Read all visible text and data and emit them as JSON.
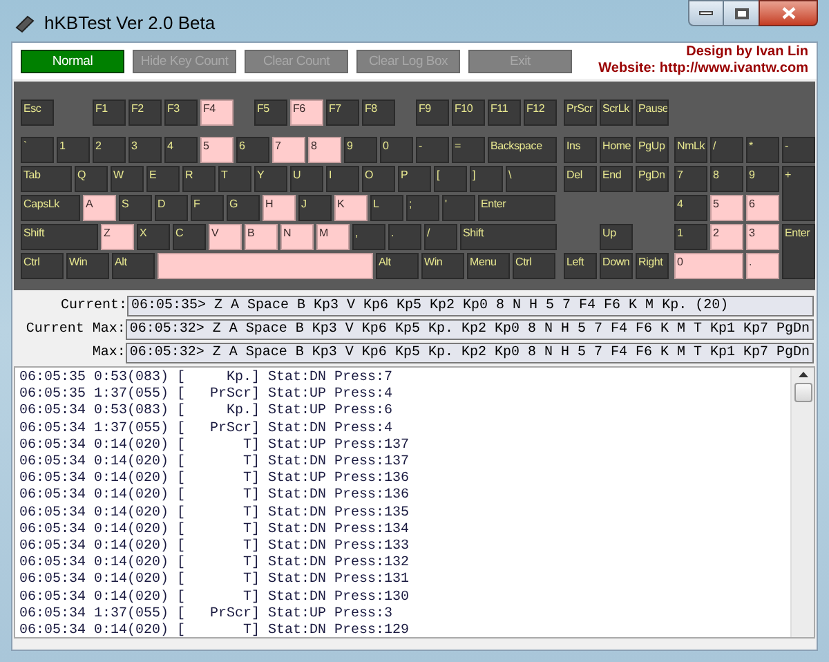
{
  "window": {
    "title": "hKBTest Ver 2.0 Beta"
  },
  "toolbar": {
    "buttons": [
      {
        "label": "Normal",
        "selected": true
      },
      {
        "label": "Hide Key Count",
        "selected": false
      },
      {
        "label": "Clear Count",
        "selected": false
      },
      {
        "label": "Clear Log Box",
        "selected": false
      },
      {
        "label": "Exit",
        "selected": false
      }
    ],
    "credits": [
      "Design by Ivan Lin",
      "Website: http://www.ivantw.com"
    ]
  },
  "keyboard": {
    "function_keys": [
      {
        "label": "Esc",
        "pressed": false
      },
      {
        "label": "F1",
        "pressed": false
      },
      {
        "label": "F2",
        "pressed": false
      },
      {
        "label": "F3",
        "pressed": false
      },
      {
        "label": "F4",
        "pressed": true
      },
      {
        "label": "F5",
        "pressed": false
      },
      {
        "label": "F6",
        "pressed": true
      },
      {
        "label": "F7",
        "pressed": false
      },
      {
        "label": "F8",
        "pressed": false
      },
      {
        "label": "F9",
        "pressed": false
      },
      {
        "label": "F10",
        "pressed": false
      },
      {
        "label": "F11",
        "pressed": false
      },
      {
        "label": "F12",
        "pressed": false
      }
    ],
    "main_rows": [
      [
        {
          "label": "`",
          "pressed": false
        },
        {
          "label": "1",
          "pressed": false
        },
        {
          "label": "2",
          "pressed": false
        },
        {
          "label": "3",
          "pressed": false
        },
        {
          "label": "4",
          "pressed": false
        },
        {
          "label": "5",
          "pressed": true
        },
        {
          "label": "6",
          "pressed": false
        },
        {
          "label": "7",
          "pressed": true
        },
        {
          "label": "8",
          "pressed": true
        },
        {
          "label": "9",
          "pressed": false
        },
        {
          "label": "0",
          "pressed": false
        },
        {
          "label": "-",
          "pressed": false
        },
        {
          "label": "=",
          "pressed": false
        },
        {
          "label": "Backspace",
          "pressed": false
        }
      ],
      [
        {
          "label": "Tab",
          "pressed": false
        },
        {
          "label": "Q",
          "pressed": false
        },
        {
          "label": "W",
          "pressed": false
        },
        {
          "label": "E",
          "pressed": false
        },
        {
          "label": "R",
          "pressed": false
        },
        {
          "label": "T",
          "pressed": false
        },
        {
          "label": "Y",
          "pressed": false
        },
        {
          "label": "U",
          "pressed": false
        },
        {
          "label": "I",
          "pressed": false
        },
        {
          "label": "O",
          "pressed": false
        },
        {
          "label": "P",
          "pressed": false
        },
        {
          "label": "[",
          "pressed": false
        },
        {
          "label": "]",
          "pressed": false
        },
        {
          "label": "\\",
          "pressed": false
        }
      ],
      [
        {
          "label": "CapsLk",
          "pressed": false
        },
        {
          "label": "A",
          "pressed": true
        },
        {
          "label": "S",
          "pressed": false
        },
        {
          "label": "D",
          "pressed": false
        },
        {
          "label": "F",
          "pressed": false
        },
        {
          "label": "G",
          "pressed": false
        },
        {
          "label": "H",
          "pressed": true
        },
        {
          "label": "J",
          "pressed": false
        },
        {
          "label": "K",
          "pressed": true
        },
        {
          "label": "L",
          "pressed": false
        },
        {
          "label": ";",
          "pressed": false
        },
        {
          "label": "'",
          "pressed": false
        },
        {
          "label": "Enter",
          "pressed": false
        }
      ],
      [
        {
          "label": "Shift",
          "pressed": false
        },
        {
          "label": "Z",
          "pressed": true
        },
        {
          "label": "X",
          "pressed": false
        },
        {
          "label": "C",
          "pressed": false
        },
        {
          "label": "V",
          "pressed": true
        },
        {
          "label": "B",
          "pressed": true
        },
        {
          "label": "N",
          "pressed": true
        },
        {
          "label": "M",
          "pressed": true
        },
        {
          "label": ",",
          "pressed": false
        },
        {
          "label": ".",
          "pressed": false
        },
        {
          "label": "/",
          "pressed": false
        },
        {
          "label": "Shift",
          "pressed": false
        }
      ],
      [
        {
          "kind": "key",
          "label": "Ctrl",
          "pressed": false
        },
        {
          "kind": "key",
          "label": "Win",
          "pressed": false
        },
        {
          "kind": "key",
          "label": "Alt",
          "pressed": false
        },
        {
          "kind": "space",
          "pressed": true
        },
        {
          "kind": "key",
          "label": "Alt",
          "pressed": false
        },
        {
          "kind": "key",
          "label": "Win",
          "pressed": false
        },
        {
          "kind": "key",
          "label": "Menu",
          "pressed": false
        },
        {
          "kind": "key",
          "label": "Ctrl",
          "pressed": false
        }
      ]
    ],
    "nav_keys": [
      {
        "label": "PrScr",
        "pressed": false
      },
      {
        "label": "ScrLk",
        "pressed": false
      },
      {
        "label": "Pause",
        "pressed": false
      },
      {
        "label": "Ins",
        "pressed": false
      },
      {
        "label": "Home",
        "pressed": false
      },
      {
        "label": "PgUp",
        "pressed": false
      },
      {
        "label": "Del",
        "pressed": false
      },
      {
        "label": "End",
        "pressed": false
      },
      {
        "label": "PgDn",
        "pressed": false
      },
      {
        "label": "Up",
        "pressed": false
      },
      {
        "label": "Left",
        "pressed": false
      },
      {
        "label": "Down",
        "pressed": false
      },
      {
        "label": "Right",
        "pressed": false
      }
    ],
    "numpad_keys": [
      {
        "label": "NmLk",
        "pressed": false
      },
      {
        "label": "/",
        "pressed": false
      },
      {
        "label": "*",
        "pressed": false
      },
      {
        "label": "-",
        "pressed": false
      },
      {
        "label": "7",
        "pressed": false
      },
      {
        "label": "8",
        "pressed": false
      },
      {
        "label": "9",
        "pressed": false
      },
      {
        "label": "+",
        "pressed": false
      },
      {
        "label": "4",
        "pressed": false
      },
      {
        "label": "5",
        "pressed": true
      },
      {
        "label": "6",
        "pressed": true
      },
      {
        "label": "1",
        "pressed": false
      },
      {
        "label": "2",
        "pressed": true
      },
      {
        "label": "3",
        "pressed": true
      },
      {
        "label": "Enter",
        "pressed": false
      },
      {
        "label": "0",
        "pressed": true
      },
      {
        "label": ".",
        "pressed": true
      }
    ]
  },
  "status": [
    {
      "label": "Current:",
      "value": "06:05:35> Z A Space B Kp3 V Kp6 Kp5 Kp2 Kp0 8 N H 5 7 F4 F6 K M Kp. (20)"
    },
    {
      "label": "Current Max:",
      "value": "06:05:32> Z A Space B Kp3 V Kp6 Kp5 Kp. Kp2 Kp0 8 N H 5 7 F4 F6 K M T Kp1 Kp7 PgDn"
    },
    {
      "label": "Max:",
      "value": "06:05:32> Z A Space B Kp3 V Kp6 Kp5 Kp. Kp2 Kp0 8 N H 5 7 F4 F6 K M T Kp1 Kp7 PgDn"
    }
  ],
  "log": [
    "06:05:35 0:53(083) [     Kp.] Stat:DN Press:7",
    "06:05:35 1:37(055) [   PrScr] Stat:UP Press:4",
    "06:05:34 0:53(083) [     Kp.] Stat:UP Press:6",
    "06:05:34 1:37(055) [   PrScr] Stat:DN Press:4",
    "06:05:34 0:14(020) [       T] Stat:UP Press:137",
    "06:05:34 0:14(020) [       T] Stat:DN Press:137",
    "06:05:34 0:14(020) [       T] Stat:UP Press:136",
    "06:05:34 0:14(020) [       T] Stat:DN Press:136",
    "06:05:34 0:14(020) [       T] Stat:DN Press:135",
    "06:05:34 0:14(020) [       T] Stat:DN Press:134",
    "06:05:34 0:14(020) [       T] Stat:DN Press:133",
    "06:05:34 0:14(020) [       T] Stat:DN Press:132",
    "06:05:34 0:14(020) [       T] Stat:DN Press:131",
    "06:05:34 0:14(020) [       T] Stat:DN Press:130",
    "06:05:34 1:37(055) [   PrScr] Stat:UP Press:3",
    "06:05:34 0:14(020) [       T] Stat:DN Press:129"
  ]
}
